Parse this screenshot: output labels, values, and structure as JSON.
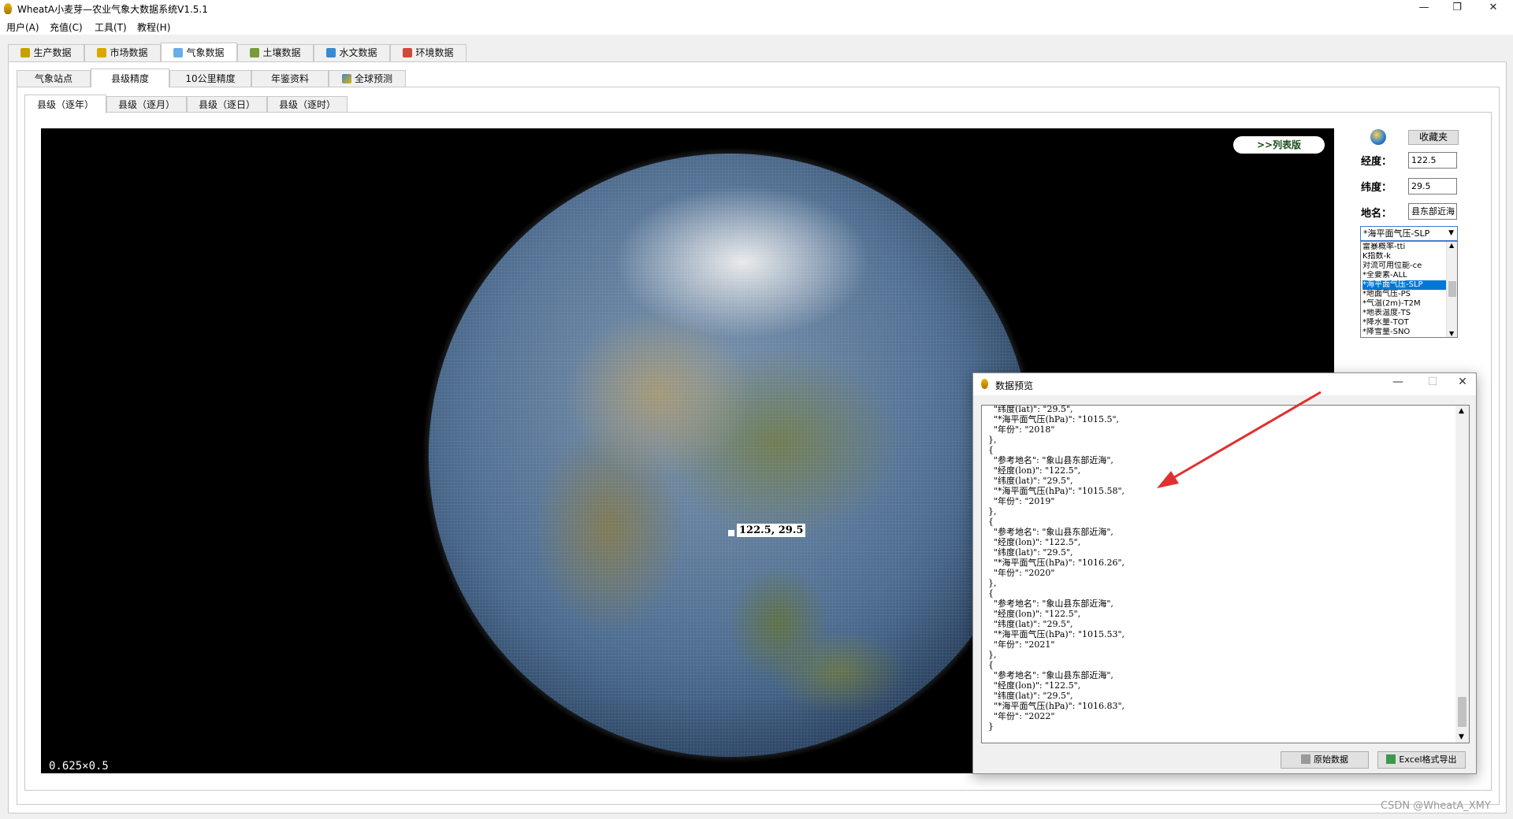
{
  "window": {
    "title": "WheatA小麦芽—农业气象大数据系统V1.5.1",
    "minimize": "—",
    "maximize": "❐",
    "close": "✕"
  },
  "menu": [
    "用户(A)",
    "充值(C)",
    "工具(T)",
    "教程(H)"
  ],
  "main_tabs": [
    {
      "label": "生产数据",
      "icon": "wheat-icon",
      "color": "#c8a000"
    },
    {
      "label": "市场数据",
      "icon": "wheat-stalk-icon",
      "color": "#d8a800"
    },
    {
      "label": "气象数据",
      "icon": "cloud-icon",
      "color": "#6aaee8",
      "active": true
    },
    {
      "label": "土壤数据",
      "icon": "plant-icon",
      "color": "#7a9a3a"
    },
    {
      "label": "水文数据",
      "icon": "water-icon",
      "color": "#3a8ad0"
    },
    {
      "label": "环境数据",
      "icon": "car-icon",
      "color": "#d04a3a"
    }
  ],
  "sub_tabs": [
    {
      "label": "气象站点"
    },
    {
      "label": "县级精度",
      "active": true
    },
    {
      "label": "10公里精度"
    },
    {
      "label": "年鉴资料"
    },
    {
      "label": "全球预测",
      "icon": "chart-icon"
    }
  ],
  "county_tabs": [
    {
      "label": "县级（逐年）",
      "active": true
    },
    {
      "label": "县级（逐月）"
    },
    {
      "label": "县级（逐日）"
    },
    {
      "label": "县级（逐时）"
    }
  ],
  "map": {
    "marker_label": "122.5, 29.5",
    "scale_readout": "0.625×0.5",
    "list_button": ">>列表版"
  },
  "controls": {
    "favorites": "收藏夹",
    "lon_label": "经度：",
    "lon_value": "122.5",
    "lat_label": "纬度：",
    "lat_value": "29.5",
    "place_label": "地名：",
    "place_value": "县东部近海",
    "variable_selected": "*海平面气压-SLP",
    "variable_options": [
      "雷暴概率-tti",
      "K指数-k",
      "对流可用位能-ce",
      "*全要素-ALL",
      "*海平面气压-SLP",
      "*地面气压-PS",
      "*气温(2m)-T2M",
      "*地表温度-TS",
      "*降水量-TOT",
      "*降雪量-SNO"
    ],
    "variable_selected_index": 4
  },
  "dialog": {
    "title": "数据预览",
    "lines": [
      "  \"纬度(lat)\": \"29.5\",",
      "  \"*海平面气压(hPa)\": \"1015.5\",",
      "  \"年份\": \"2018\"",
      "},",
      "{",
      "  \"参考地名\": \"象山县东部近海\",",
      "  \"经度(lon)\": \"122.5\",",
      "  \"纬度(lat)\": \"29.5\",",
      "  \"*海平面气压(hPa)\": \"1015.58\",",
      "  \"年份\": \"2019\"",
      "},",
      "{",
      "  \"参考地名\": \"象山县东部近海\",",
      "  \"经度(lon)\": \"122.5\",",
      "  \"纬度(lat)\": \"29.5\",",
      "  \"*海平面气压(hPa)\": \"1016.26\",",
      "  \"年份\": \"2020\"",
      "},",
      "{",
      "  \"参考地名\": \"象山县东部近海\",",
      "  \"经度(lon)\": \"122.5\",",
      "  \"纬度(lat)\": \"29.5\",",
      "  \"*海平面气压(hPa)\": \"1015.53\",",
      "  \"年份\": \"2021\"",
      "},",
      "{",
      "  \"参考地名\": \"象山县东部近海\",",
      "  \"经度(lon)\": \"122.5\",",
      "  \"纬度(lat)\": \"29.5\",",
      "  \"*海平面气压(hPa)\": \"1016.83\",",
      "  \"年份\": \"2022\"",
      "}"
    ],
    "raw_button": "原始数据",
    "export_button": "Excel格式导出"
  },
  "watermark": "CSDN @WheatA_XMY",
  "colors": {
    "annotation_arrow": "#e03030",
    "selection": "#0078d7"
  }
}
